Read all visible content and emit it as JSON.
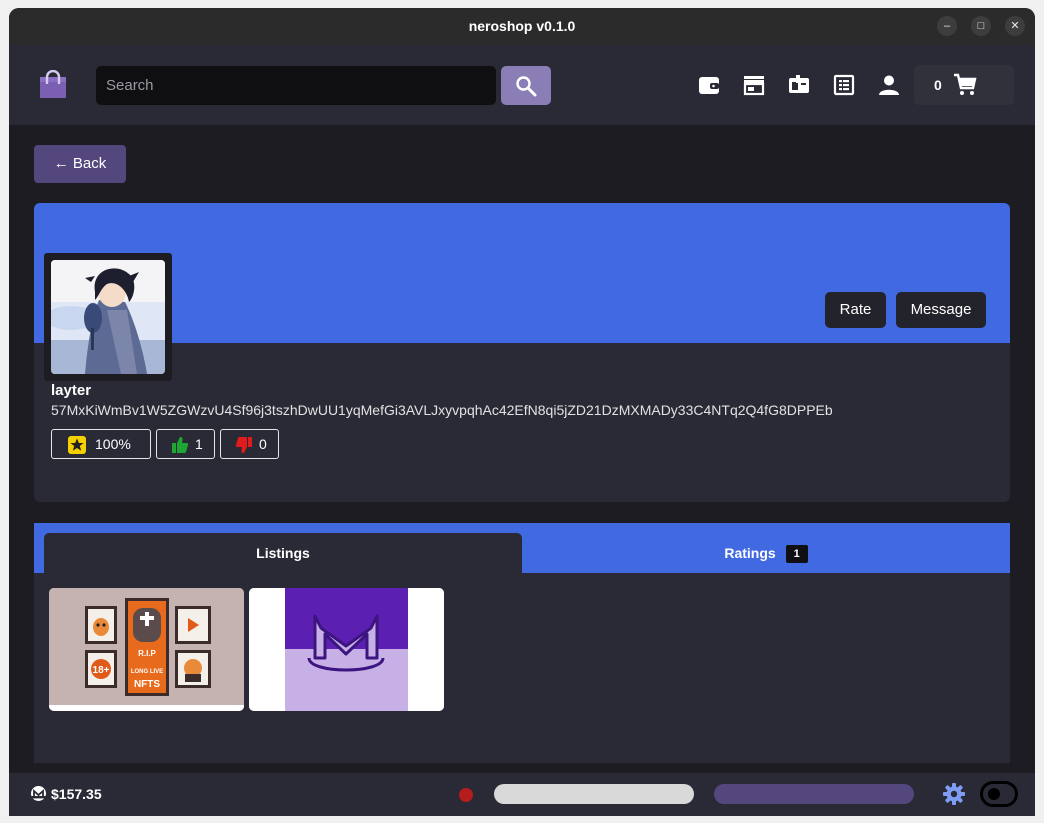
{
  "window": {
    "title": "neroshop v0.1.0",
    "controls": {
      "minimize": "–",
      "maximize": "□",
      "close": "✕"
    }
  },
  "header": {
    "logo_icon": "shopping-bag-icon",
    "search": {
      "placeholder": "Search",
      "value": ""
    },
    "nav_icons": [
      "wallet-icon",
      "store-icon",
      "inventory-icon",
      "orders-icon",
      "account-icon"
    ],
    "cart": {
      "count": "0",
      "icon": "cart-icon"
    }
  },
  "back_button": {
    "label": "← Back"
  },
  "profile": {
    "username": "layter",
    "address": "57MxKiWmBv1W5ZGWzvU4Sf96j3tszhDwUU1yqMefGi3AVLJxyvpqhAc42EfN8qi5jZD21DzMXMADy33C4NTq2Q4fG8DPPEb",
    "rate_label": "Rate",
    "message_label": "Message",
    "stats": {
      "reputation": "100%",
      "thumbs_up": "1",
      "thumbs_down": "0"
    }
  },
  "tabs": {
    "listings_label": "Listings",
    "ratings_label": "Ratings",
    "ratings_count": "1"
  },
  "listings": [
    {
      "name": "nft-poster-listing",
      "image": "rip-nfts-poster"
    },
    {
      "name": "monero-logo-listing",
      "image": "monero-cat-logo"
    }
  ],
  "statusbar": {
    "balance": "$157.35",
    "currency_icon": "monero-icon",
    "sync_dot_color": "#b51d1d",
    "settings_icon": "gear-icon"
  },
  "colors": {
    "accent": "#4169e1",
    "purple": "#54477e",
    "panel": "#292a36",
    "background": "#1c1c22"
  }
}
